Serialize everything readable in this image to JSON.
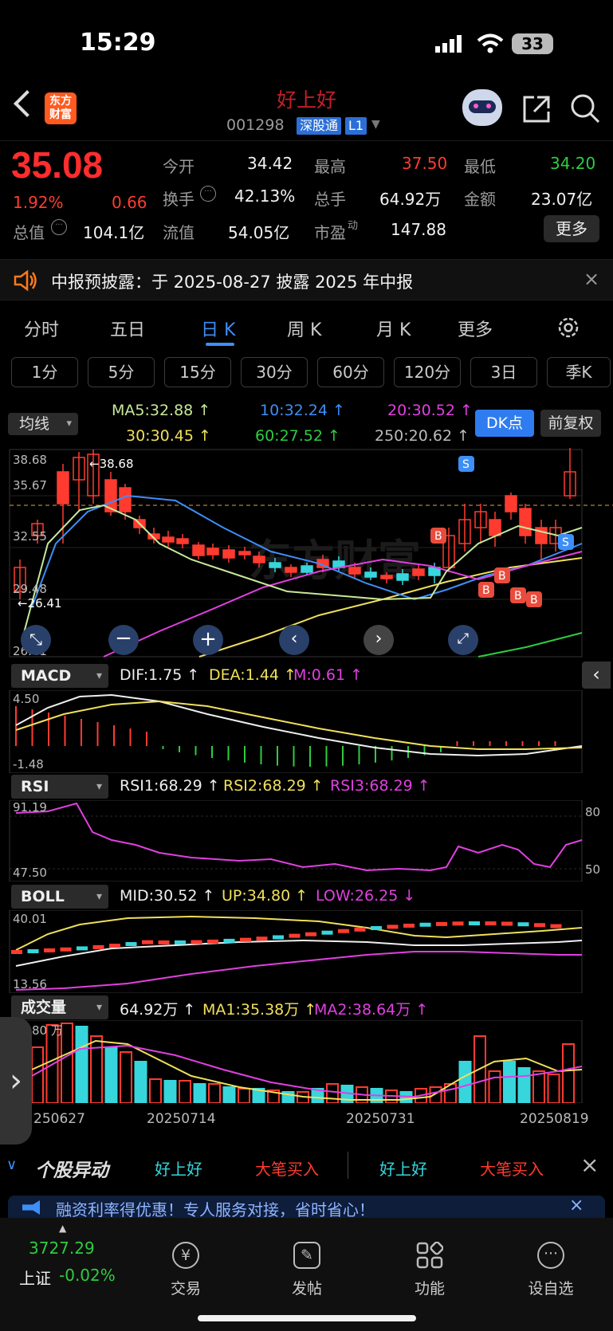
{
  "status": {
    "time": "15:29",
    "battery": "33"
  },
  "nav": {
    "name": "好上好",
    "code": "001298",
    "tag1": "深股通",
    "tag2": "L1",
    "logo": "东方\n财富"
  },
  "quote": {
    "price": "35.08",
    "pct": "1.92%",
    "chg": "0.66",
    "rows": [
      [
        {
          "label": "今开",
          "value": "34.42"
        },
        {
          "label": "最高",
          "value": "37.50",
          "color": "red"
        },
        {
          "label": "最低",
          "value": "34.20",
          "color": "green"
        }
      ],
      [
        {
          "label": "换手",
          "value": "42.13%"
        },
        {
          "label": "总手",
          "value": "64.92万"
        },
        {
          "label": "金额",
          "value": "23.07亿"
        }
      ],
      [
        {
          "label": "总值",
          "value": "104.1亿"
        },
        {
          "label": "流值",
          "value": "54.05亿"
        },
        {
          "label": "市盈",
          "sup": "动",
          "value": "147.88"
        }
      ]
    ],
    "more": "更多"
  },
  "notice": {
    "text": "中报预披露：于 2025-08-27 披露 2025 年中报"
  },
  "tabs": [
    "分时",
    "五日",
    "日 K",
    "周 K",
    "月 K",
    "更多"
  ],
  "subtabs": [
    "1分",
    "5分",
    "15分",
    "30分",
    "60分",
    "120分",
    "3日",
    "季K"
  ],
  "ma": {
    "selector": "均线",
    "ma5": "MA5:32.88 ↑",
    "ma10": "10:32.24 ↑",
    "ma20": "20:30.52 ↑",
    "ma30": "30:30.45 ↑",
    "ma60": "60:27.52 ↑",
    "ma250": "250:20.62 ↑",
    "dk": "DK点",
    "fuquan": "前复权",
    "y_top": "38.68",
    "y2": "35.67",
    "y3": "32.55",
    "y4": "29.48",
    "y_bottom": "26.41",
    "high_mark": "←38.68",
    "low_mark": "←26.41"
  },
  "macd": {
    "label": "MACD",
    "dif": "DIF:1.75 ↑",
    "dea": "DEA:1.44 ↑",
    "m": "M:0.61 ↑",
    "y_top": "4.50",
    "y_bottom": "-1.48"
  },
  "rsi": {
    "label": "RSI",
    "r1": "RSI1:68.29 ↑",
    "r2": "RSI2:68.29 ↑",
    "r3": "RSI3:68.29 ↑",
    "y_top": "91.19",
    "y_bottom": "47.50",
    "l80": "80",
    "l50": "50"
  },
  "boll": {
    "label": "BOLL",
    "mid": "MID:30.52 ↑",
    "up": "UP:34.80 ↑",
    "low": "LOW:26.25 ↓",
    "y_top": "40.01",
    "y_bottom": "13.56"
  },
  "vol": {
    "label": "成交量",
    "v": "64.92万 ↑",
    "ma1": "MA1:35.38万 ↑",
    "ma2": "MA2:38.64万 ↑",
    "y_top": "80 万"
  },
  "dates": [
    "250627",
    "20250714",
    "20250731",
    "20250819"
  ],
  "ticker": {
    "title": "个股异动",
    "items": [
      {
        "name": "好上好",
        "event": "大笔买入"
      },
      {
        "name": "好上好",
        "event": "大笔买入"
      }
    ]
  },
  "banner": {
    "text": "融资利率得优惠！专人服务对接，省时省心！"
  },
  "index": {
    "value": "3727.29",
    "name": "上证",
    "pct": "-0.02%"
  },
  "bottom_nav": [
    "交易",
    "发帖",
    "功能",
    "设自选"
  ],
  "colors": {
    "up": "#ff3b30",
    "down": "#2ecc40",
    "accent": "#3e8ef7",
    "cyan": "#36d6dc",
    "yellow": "#f0e05a",
    "magenta": "#e040e0"
  }
}
